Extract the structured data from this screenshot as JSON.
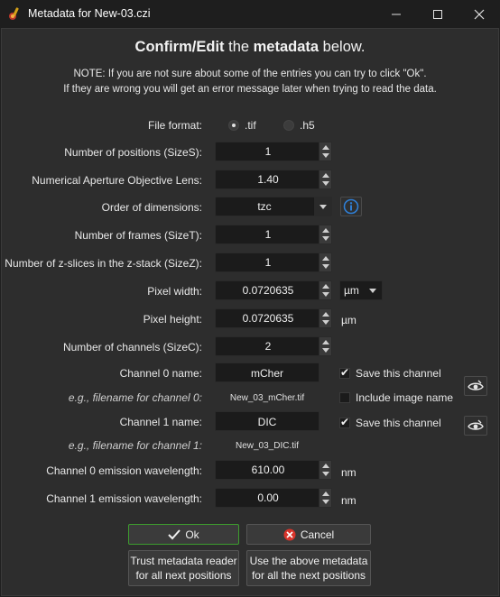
{
  "window": {
    "title": "Metadata for New-03.czi",
    "controls": {
      "minimize": "minimize-icon",
      "maximize": "maximize-icon",
      "close": "close-icon"
    }
  },
  "heading": {
    "part1": "Confirm/Edit",
    "part2": " the ",
    "part3": "metadata",
    "part4": " below."
  },
  "note": {
    "line1": "NOTE: If you are not sure about some of the entries you can try to click \"Ok\".",
    "line2": "If they are wrong you will get an error message later when trying to read the data."
  },
  "form": {
    "file_format": {
      "label": "File format:",
      "options": [
        ".tif",
        ".h5"
      ],
      "selected": ".tif"
    },
    "size_s": {
      "label": "Number of positions (SizeS):",
      "value": "1"
    },
    "na": {
      "label": "Numerical Aperture Objective Lens:",
      "value": "1.40"
    },
    "order": {
      "label": "Order of dimensions:",
      "value": "tzc"
    },
    "size_t": {
      "label": "Number of frames (SizeT):",
      "value": "1"
    },
    "size_z": {
      "label": "Number of z-slices in the z-stack (SizeZ):",
      "value": "1"
    },
    "pixel_width": {
      "label": "Pixel width:",
      "value": "0.0720635",
      "unit": "µm"
    },
    "pixel_height": {
      "label": "Pixel height:",
      "value": "0.0720635",
      "unit": "µm"
    },
    "size_c": {
      "label": "Number of channels (SizeC):",
      "value": "2"
    },
    "ch0_name": {
      "label": "Channel 0 name:",
      "value": "mCher",
      "save_label": "Save this channel",
      "save_checked": true
    },
    "ch0_example": {
      "label": "e.g., filename for channel 0:",
      "value": "New_03_mCher.tif",
      "include_label": "Include image name",
      "include_checked": false
    },
    "ch1_name": {
      "label": "Channel 1 name:",
      "value": "DIC",
      "save_label": "Save this channel",
      "save_checked": true
    },
    "ch1_example": {
      "label": "e.g., filename for channel 1:",
      "value": "New_03_DIC.tif"
    },
    "ch0_wavelength": {
      "label": "Channel 0 emission wavelength:",
      "value": "610.00",
      "unit": "nm"
    },
    "ch1_wavelength": {
      "label": "Channel 1 emission wavelength:",
      "value": "0.00",
      "unit": "nm"
    }
  },
  "buttons": {
    "ok": "Ok",
    "cancel": "Cancel",
    "trust_line1": "Trust metadata reader",
    "trust_line2": "for all next positions",
    "use_line1": "Use the above metadata",
    "use_line2": "for all the next positions"
  },
  "colors": {
    "ok_border": "#3d9c2e",
    "cancel_icon": "#d9342b",
    "info_icon": "#2f7fd6"
  }
}
